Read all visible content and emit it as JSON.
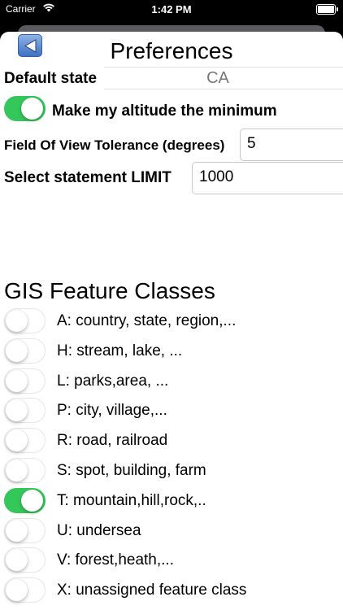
{
  "status_bar": {
    "carrier": "Carrier",
    "time": "1:42 PM"
  },
  "page": {
    "title": "Preferences"
  },
  "settings": {
    "default_state_label": "Default state",
    "default_state_value": "CA",
    "altitude_label": "Make my altitude the minimum",
    "altitude_on": true,
    "fov_label": "Field Of View Tolerance (degrees)",
    "fov_value": "5",
    "limit_label": "Select statement LIMIT",
    "limit_value": "1000"
  },
  "gis": {
    "title": "GIS Feature Classes",
    "classes": [
      {
        "label": "A: country, state, region,...",
        "on": false
      },
      {
        "label": "H: stream, lake, ...",
        "on": false
      },
      {
        "label": "L: parks,area, ...",
        "on": false
      },
      {
        "label": "P: city, village,...",
        "on": false
      },
      {
        "label": "R: road, railroad",
        "on": false
      },
      {
        "label": "S: spot, building, farm",
        "on": false
      },
      {
        "label": "T: mountain,hill,rock,..",
        "on": true
      },
      {
        "label": "U: undersea",
        "on": false
      },
      {
        "label": "V: forest,heath,...",
        "on": false
      },
      {
        "label": "X: unassigned feature class",
        "on": false
      }
    ]
  },
  "colors": {
    "toggle_on": "#34c759",
    "back_button": "#3f72c4"
  }
}
